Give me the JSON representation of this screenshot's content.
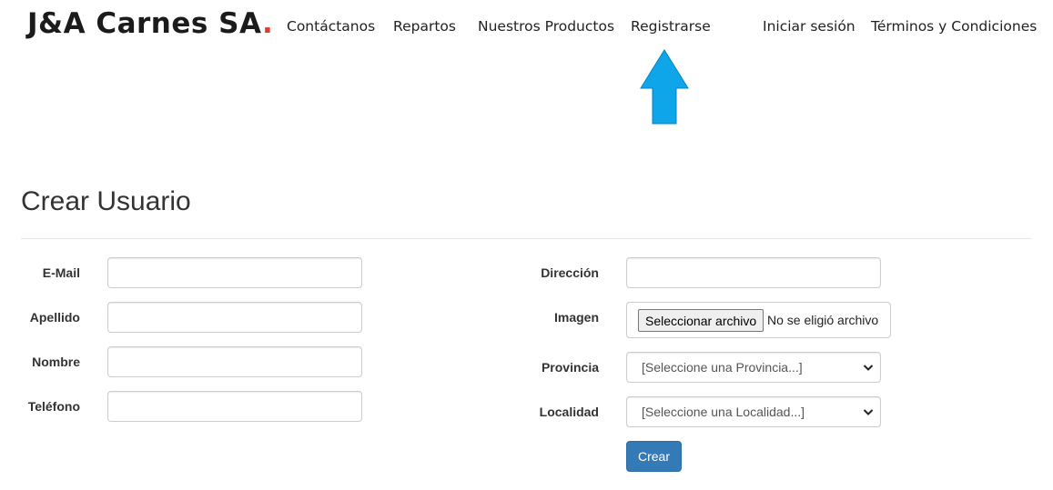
{
  "header": {
    "brand": "J&A Carnes SA",
    "brand_dot": ".",
    "nav": {
      "contact": "Contáctanos",
      "deliveries": "Repartos",
      "products": "Nuestros Productos",
      "register": "Registrarse",
      "login": "Iniciar sesión",
      "terms": "Términos y Condiciones"
    }
  },
  "page": {
    "title": "Crear Usuario"
  },
  "form": {
    "email_label": "E-Mail",
    "email_value": "",
    "lastname_label": "Apellido",
    "lastname_value": "",
    "name_label": "Nombre",
    "name_value": "",
    "phone_label": "Teléfono",
    "phone_value": "",
    "address_label": "Dirección",
    "address_value": "",
    "image_label": "Imagen",
    "file_button": "Seleccionar archivo",
    "file_status": "No se eligió archivo",
    "province_label": "Provincia",
    "province_selected": "[Seleccione una Provincia...]",
    "locality_label": "Localidad",
    "locality_selected": "[Seleccione una Localidad...]",
    "submit_label": "Crear"
  },
  "icons": {
    "arrow": "arrow-up-icon",
    "select_chevron": "chevron-down-icon"
  },
  "colors": {
    "brand_dot": "#e03a2c",
    "arrow": "#0ea5e9",
    "primary_button": "#337ab7"
  }
}
